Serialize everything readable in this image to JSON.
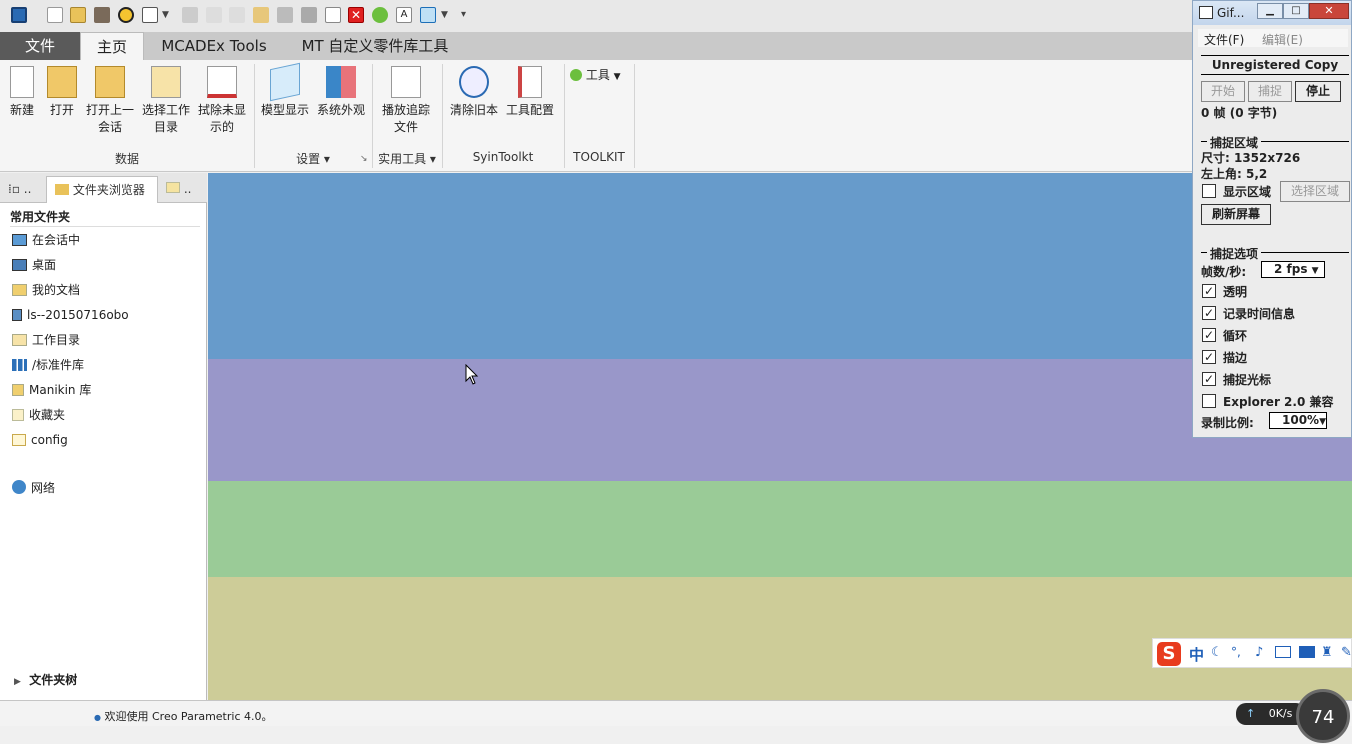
{
  "colors": {
    "band1": "#679bcb",
    "band2": "#9997c9",
    "band3": "#9acb97",
    "band4": "#cdcc98",
    "accent": "#5a5a5a"
  },
  "tabs": {
    "file": "文件",
    "home": "主页",
    "mcadex": "MCADEx Tools",
    "mt": "MT 自定义零件库工具"
  },
  "ribbon": {
    "new": "新建",
    "open": "打开",
    "open_last_1": "打开上一",
    "open_last_2": "会话",
    "select_wd_1": "选择工作",
    "select_wd_2": "目录",
    "erase_1": "拭除未显",
    "erase_2": "示的",
    "model_display": "模型显示",
    "system_look": "系统外观",
    "playback_1": "播放追踪",
    "playback_2": "文件",
    "clear_old": "清除旧本",
    "tool_config": "工具配置",
    "tools_drop": "工具",
    "group_data": "数据",
    "group_settings": "设置",
    "group_utilities": "实用工具",
    "group_syin": "SyinToolkt",
    "group_toolkit": "TOOLKIT"
  },
  "panel": {
    "tab_folder_browser": "文件夹浏览器",
    "tab_more1": "..",
    "tab_more2": "..",
    "common_header": "常用文件夹",
    "items": [
      "在会话中",
      "桌面",
      "我的文档",
      "ls--20150716obo",
      "工作目录",
      "/标准件库",
      "Manikin 库",
      "收藏夹",
      "config"
    ],
    "network": "网络",
    "folder_tree": "文件夹树"
  },
  "status": {
    "message": "欢迎使用 Creo Parametric 4.0。",
    "net_speed": "0K/s",
    "gauge": "74"
  },
  "gif": {
    "title": "Gif...",
    "menu_file": "文件(F)",
    "menu_edit": "编辑(E)",
    "unregistered": "Unregistered Copy",
    "start": "开始",
    "capture": "捕捉",
    "stop": "停止",
    "frames": "0 帧 (0 字节)",
    "area_header": "捕捉区域",
    "size": "尺寸: 1352x726",
    "topleft": "左上角: 5,2",
    "show_area": "显示区域",
    "select_area": "选择区域",
    "refresh": "刷新屏幕",
    "options_header": "捕捉选项",
    "fps_label": "帧数/秒:",
    "fps_value": "2 fps",
    "opt_transparent": "透明",
    "opt_timeinfo": "记录时间信息",
    "opt_loop": "循环",
    "opt_border": "描边",
    "opt_cursor": "捕捉光标",
    "opt_explorer": "Explorer 2.0 兼容",
    "scale_label": "录制比例:",
    "scale_value": "100%"
  },
  "ime": {
    "lang": "中"
  }
}
